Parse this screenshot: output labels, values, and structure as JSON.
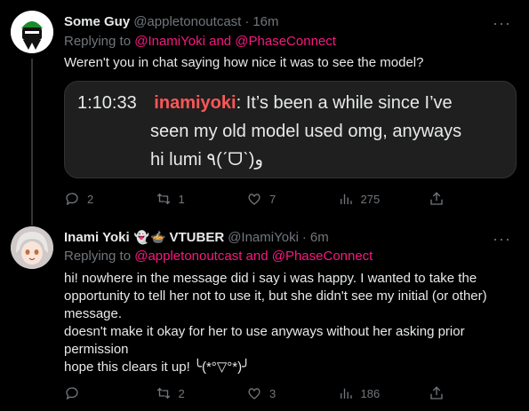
{
  "tweet1": {
    "name": "Some Guy",
    "handle": "@appletonoutcast",
    "time": "16m",
    "replying_prefix": "Replying to",
    "mentions": "@InamiYoki and @PhaseConnect",
    "text": "Weren't you in chat saying how nice it was to see the model?",
    "quote": {
      "timestamp": "1:10:33",
      "username": "inamiyoki",
      "line1": "It’s been a while since I’ve",
      "line2": "seen my old model used omg, anyways",
      "line3": "hi lumi ٩(ˊᗜˋ)و"
    },
    "actions": {
      "replies": "2",
      "retweets": "1",
      "likes": "7",
      "views": "275"
    }
  },
  "tweet2": {
    "name": "Inami Yoki",
    "name_suffix": "VTUBER",
    "handle": "@InamiYoki",
    "time": "6m",
    "replying_prefix": "Replying to",
    "mentions": "@appletonoutcast and @PhaseConnect",
    "lines": [
      "hi! nowhere in the message did i say i was happy. I wanted to take the",
      "opportunity to tell her not to use it, but she didn't see my initial (or other)",
      "message.",
      "doesn't make it okay for her to use anyways without her asking prior",
      "permission",
      "hope this clears it up! ╰(*°▽°*)╯"
    ],
    "actions": {
      "replies": "",
      "retweets": "2",
      "likes": "3",
      "views": "186"
    }
  },
  "colors": {
    "mention": "#f91880",
    "quote_name": "#ff5757",
    "muted": "#71767b"
  }
}
